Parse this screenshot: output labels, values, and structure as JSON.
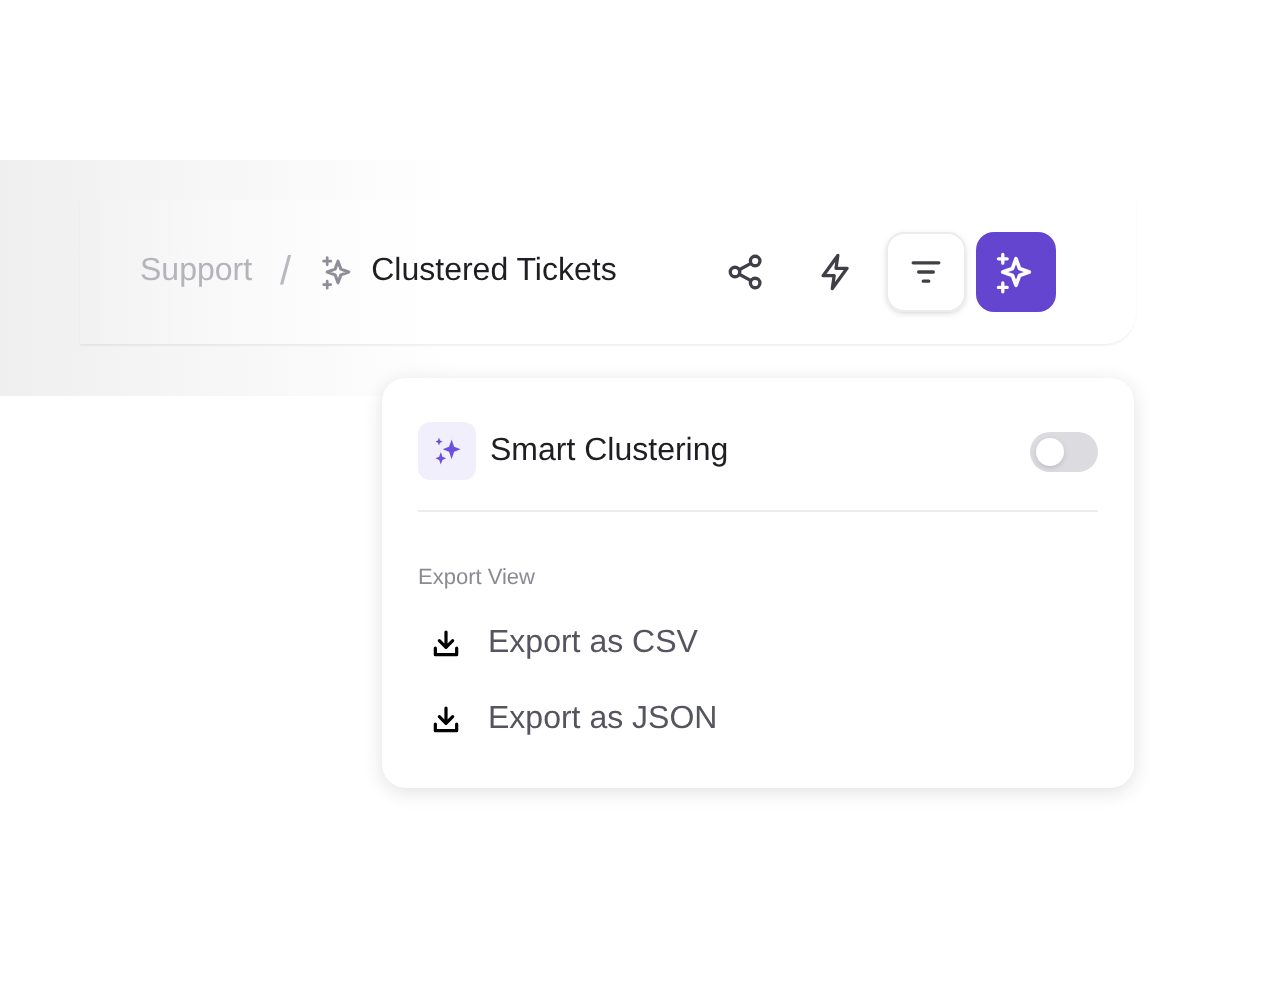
{
  "breadcrumb": [
    {
      "label": "Support",
      "current": false
    },
    {
      "label": "Clustered Tickets",
      "current": true
    }
  ],
  "separator": "/",
  "toolbar": [
    {
      "kind": "share",
      "bordered": false,
      "selected": false
    },
    {
      "kind": "bolt",
      "bordered": false,
      "selected": false
    },
    {
      "kind": "filter",
      "bordered": true,
      "selected": false
    },
    {
      "kind": "sparkle",
      "bordered": false,
      "selected": true
    }
  ],
  "menu": {
    "toggle": {
      "label": "Smart Clustering",
      "on": false
    },
    "section": "Export View",
    "items": [
      {
        "label": "Export as CSV"
      },
      {
        "label": "Export as JSON"
      }
    ]
  }
}
